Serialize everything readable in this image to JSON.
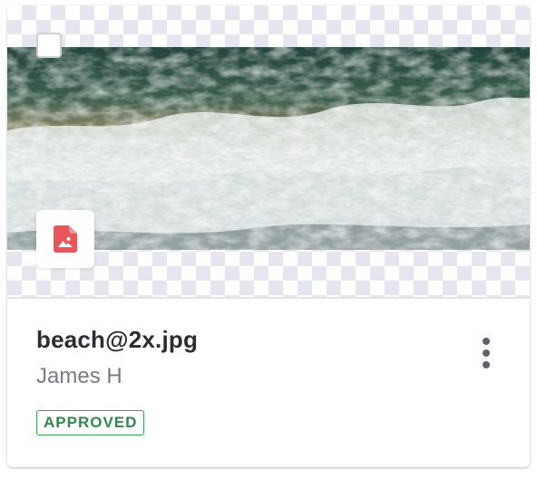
{
  "file": {
    "name": "beach@2x.jpg",
    "author": "James H",
    "status": "APPROVED",
    "type_icon": "image-file-icon"
  },
  "icons": {
    "select": "checkbox-icon",
    "menu": "more-vertical-icon"
  },
  "colors": {
    "status_text": "#2e8a48",
    "status_border": "#3aa657",
    "file_icon": "#e8555a",
    "checker": "#e6e6ef"
  }
}
